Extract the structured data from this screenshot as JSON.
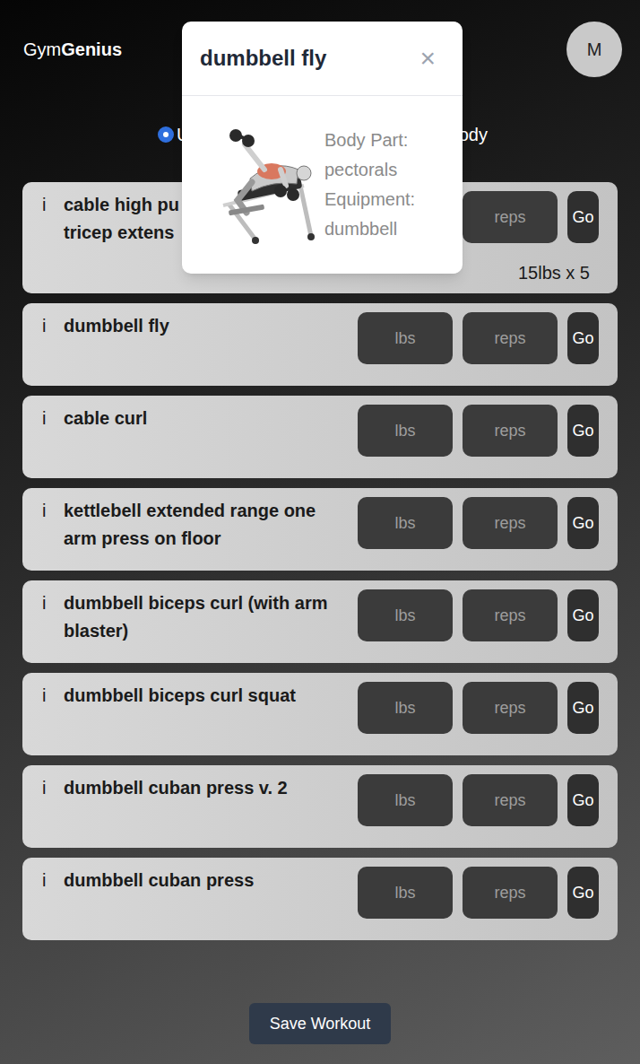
{
  "header": {
    "brand_light": "Gym",
    "brand_bold": "Genius",
    "avatar": "M"
  },
  "workout_options": [
    {
      "label": "U",
      "selected": true
    },
    {
      "label": "ody",
      "selected": false
    }
  ],
  "set_form": {
    "info": "i",
    "weight_placeholder": "lbs",
    "reps_placeholder": "reps",
    "go": "Go"
  },
  "exercises": [
    {
      "name": "cable high pu tricep extens",
      "history": "15lbs x 5"
    },
    {
      "name": "dumbbell fly",
      "history": ""
    },
    {
      "name": "cable curl",
      "history": ""
    },
    {
      "name": "kettlebell extended range one arm press on floor",
      "history": ""
    },
    {
      "name": "dumbbell biceps curl (with arm blaster)",
      "history": ""
    },
    {
      "name": "dumbbell biceps curl squat",
      "history": ""
    },
    {
      "name": "dumbbell cuban press v. 2",
      "history": ""
    },
    {
      "name": "dumbbell cuban press",
      "history": ""
    }
  ],
  "save_button": "Save Workout",
  "popup": {
    "title": "dumbbell fly",
    "close": "×",
    "details": [
      {
        "label": "Body Part:",
        "value": "pectorals"
      },
      {
        "label": "Equipment:",
        "value": "dumbbell"
      }
    ]
  }
}
